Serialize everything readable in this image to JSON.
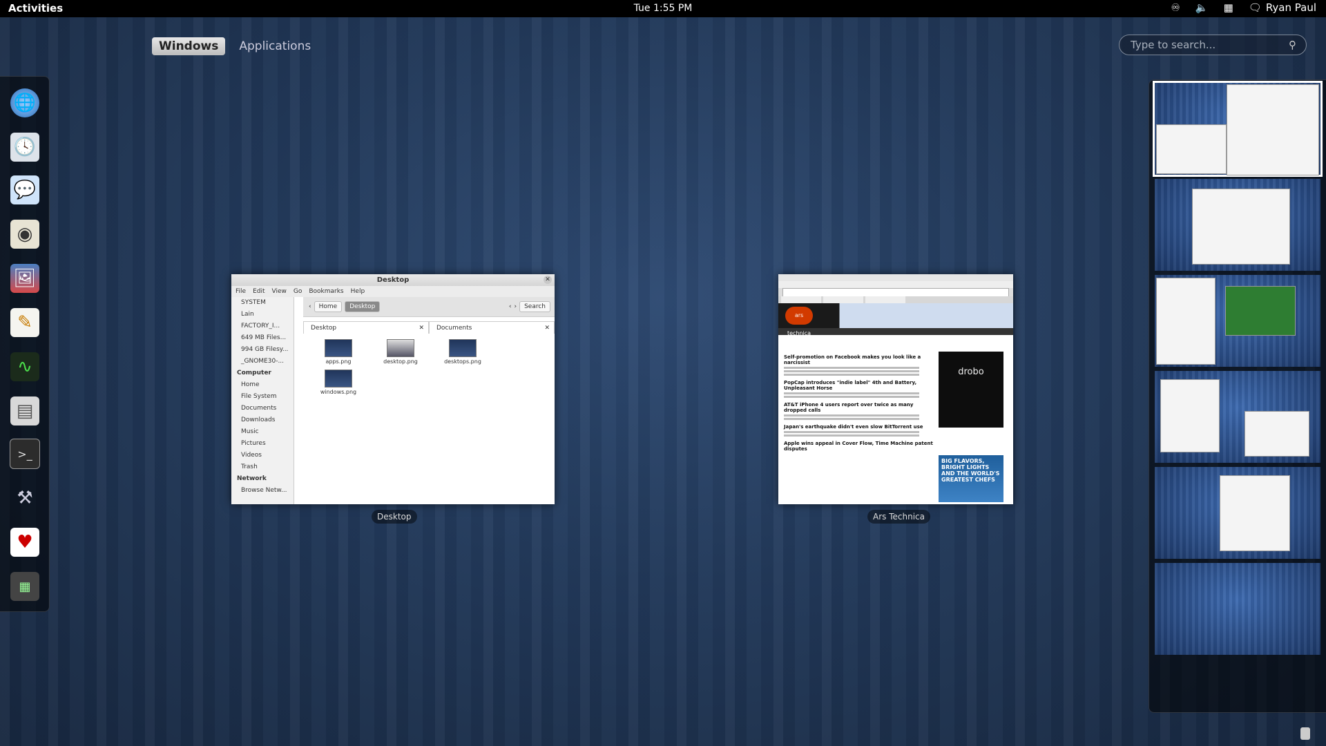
{
  "topbar": {
    "activities": "Activities",
    "clock": "Tue  1:55 PM",
    "user": "Ryan Paul",
    "tray_icons": [
      "accessibility-icon",
      "volume-icon",
      "network-icon",
      "chat-icon"
    ]
  },
  "view_tabs": [
    "Windows",
    "Applications"
  ],
  "search": {
    "placeholder": "Type to search..."
  },
  "dash": {
    "items": [
      "browser",
      "clock-mail",
      "chat",
      "speaker",
      "image-viewer",
      "text-editor",
      "system-monitor",
      "file-manager",
      "terminal",
      "settings-tools",
      "solitaire",
      "calculator"
    ]
  },
  "windows": {
    "desktop": {
      "title": "Desktop",
      "label": "Desktop",
      "menu": [
        "File",
        "Edit",
        "View",
        "Go",
        "Bookmarks",
        "Help"
      ],
      "devices": [
        "SYSTEM",
        "Lain",
        "FACTORY_I...",
        "649 MB Files...",
        "994 GB Filesy...",
        "_GNOME30-..."
      ],
      "computer_header": "Computer",
      "places": [
        "Home",
        "File System",
        "Documents",
        "Downloads",
        "Music",
        "Pictures",
        "Videos",
        "Trash"
      ],
      "network_header": "Network",
      "network": [
        "Browse Netw..."
      ],
      "crumbs": [
        "Home",
        "Desktop"
      ],
      "search_btn": "Search",
      "tabs": [
        "Desktop",
        "Documents"
      ],
      "files": [
        "apps.png",
        "desktop.png",
        "desktops.png",
        "windows.png"
      ]
    },
    "firefox": {
      "label": "Ars Technica",
      "logo": "ars technica",
      "headlines": [
        "Self-promotion on Facebook makes you look like a narcissist",
        "PopCap introduces \"indie label\" 4th and Battery, Unpleasant Horse",
        "AT&T iPhone 4 users report over twice as many dropped calls",
        "Japan's earthquake didn't even slow BitTorrent use",
        "Apple wins appeal in Cover Flow, Time Machine patent disputes"
      ],
      "ad1": "drobo",
      "ad2": "BIG FLAVORS, BRIGHT LIGHTS AND THE WORLD'S GREATEST CHEFS"
    }
  },
  "workspaces": {
    "count": 6,
    "active_index": 0
  }
}
